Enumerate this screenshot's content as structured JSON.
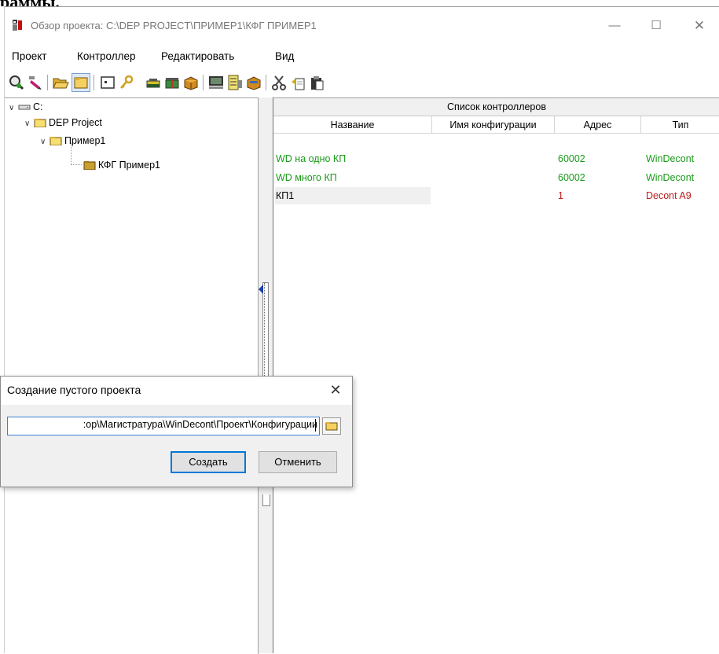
{
  "doc_cut_text": "раммы.",
  "window": {
    "title": "Обзор проекта: C:\\DEP PROJECT\\ПРИМЕР1\\КФГ ПРИМЕР1",
    "minimize": "—",
    "maximize": "☐",
    "close": "✕"
  },
  "menu": [
    "Проект",
    "Контроллер",
    "Редактировать",
    "Вид"
  ],
  "tree": {
    "drive": "C:",
    "project": "DEP Project",
    "example": "Пример1",
    "config": "КФГ Пример1"
  },
  "list": {
    "caption": "Список контроллеров",
    "columns": [
      "Название",
      "Имя конфигурации",
      "Адрес",
      "Тип"
    ],
    "rows": [
      {
        "name": "WD на одно КП",
        "config": "",
        "address": "60002",
        "type": "WinDecont",
        "color": "#1a9a1a"
      },
      {
        "name": "WD много КП",
        "config": "",
        "address": "60002",
        "type": "WinDecont",
        "color": "#1a9a1a"
      },
      {
        "name": "КП1",
        "config": "",
        "address": "1",
        "type": "Decont A9",
        "color": "#c01818"
      }
    ]
  },
  "dialog": {
    "title": "Создание пустого проекта",
    "close": "✕",
    "path_value": ":op\\Магистратура\\WinDecont\\Проект\\Конфигурации",
    "create_label": "Создать",
    "cancel_label": "Отменить"
  },
  "toolbar_icons": [
    "search-icon",
    "edit-icon",
    "open-folder-icon",
    "folder-icon",
    "new-window-icon",
    "key-icon",
    "printer-icon",
    "gift-icon",
    "box-icon",
    "screen-icon",
    "list-icon",
    "archive-icon",
    "scissors-icon",
    "copy-icon",
    "paste-icon"
  ]
}
